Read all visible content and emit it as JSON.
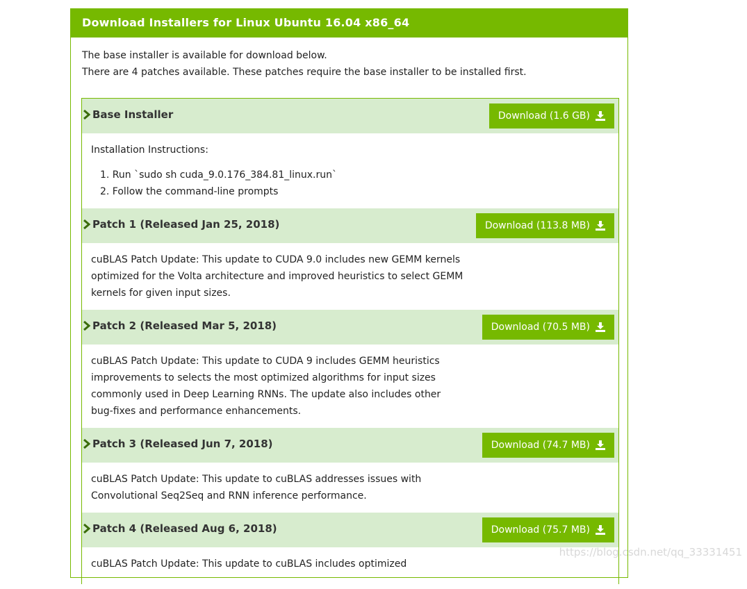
{
  "header": {
    "title": "Download Installers for Linux Ubuntu 16.04 x86_64"
  },
  "intro": {
    "line1": "The base installer is available for download below.",
    "line2": "There are 4 patches available. These patches require the base installer to be installed first."
  },
  "base": {
    "title": "Base Installer",
    "download_label": "Download (1.6 GB)",
    "instructions_label": "Installation Instructions:",
    "step1": "1. Run `sudo sh cuda_9.0.176_384.81_linux.run`",
    "step2": "2. Follow the command-line prompts"
  },
  "patches": [
    {
      "title": "Patch 1 (Released Jan 25, 2018)",
      "download_label": "Download (113.8 MB)",
      "desc_lines": [
        "cuBLAS Patch Update: This update to CUDA 9.0 includes new GEMM kernels",
        "optimized for the Volta architecture and improved heuristics to select GEMM",
        "kernels for given input sizes."
      ]
    },
    {
      "title": "Patch 2 (Released Mar 5, 2018)",
      "download_label": "Download (70.5 MB)",
      "desc_lines": [
        "cuBLAS Patch Update: This update to CUDA 9 includes GEMM heuristics",
        "improvements to selects the most optimized algorithms for input sizes",
        "commonly used in Deep Learning RNNs. The update also includes other",
        "bug-fixes and performance enhancements."
      ]
    },
    {
      "title": "Patch 3 (Released Jun 7, 2018)",
      "download_label": "Download (74.7 MB)",
      "desc_lines": [
        "cuBLAS Patch Update: This update to cuBLAS addresses issues with",
        "Convolutional Seq2Seq and RNN inference performance."
      ]
    },
    {
      "title": "Patch 4 (Released Aug 6, 2018)",
      "download_label": "Download (75.7 MB)",
      "desc_lines": [
        "cuBLAS Patch Update: This update to cuBLAS includes optimized"
      ]
    }
  ],
  "watermark": "https://blog.csdn.net/qq_33331451",
  "colors": {
    "accent": "#76b900",
    "section_bg": "#d7ecce"
  },
  "icons": {
    "expand": "chevron-right-icon",
    "download": "download-icon"
  }
}
